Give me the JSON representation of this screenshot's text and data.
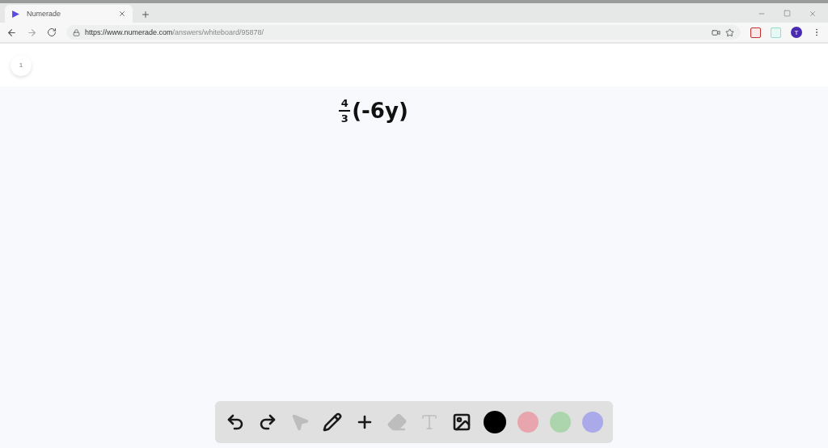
{
  "browser": {
    "tab": {
      "title": "Numerade",
      "selected": true
    },
    "url": {
      "host": "https://www.numerade.com",
      "path": "/answers/whiteboard/95878/"
    },
    "profile": "T"
  },
  "page_badge": "1",
  "whiteboard": {
    "fraction": {
      "numerator": "4",
      "denominator": "3"
    },
    "expression": "(-6y)"
  },
  "tools": [
    {
      "kind": "undo",
      "disabled": false
    },
    {
      "kind": "redo",
      "disabled": false
    },
    {
      "kind": "pointer",
      "disabled": true
    },
    {
      "kind": "pencil",
      "disabled": false
    },
    {
      "kind": "plus",
      "disabled": false
    },
    {
      "kind": "eraser",
      "disabled": true
    },
    {
      "kind": "text",
      "disabled": true
    },
    {
      "kind": "image",
      "disabled": false
    }
  ],
  "colors": [
    {
      "color": "#000000",
      "selected": true
    },
    {
      "color": "#e8a5ad",
      "selected": false
    },
    {
      "color": "#add5ad",
      "selected": false
    },
    {
      "color": "#aaaaea",
      "selected": false
    }
  ]
}
